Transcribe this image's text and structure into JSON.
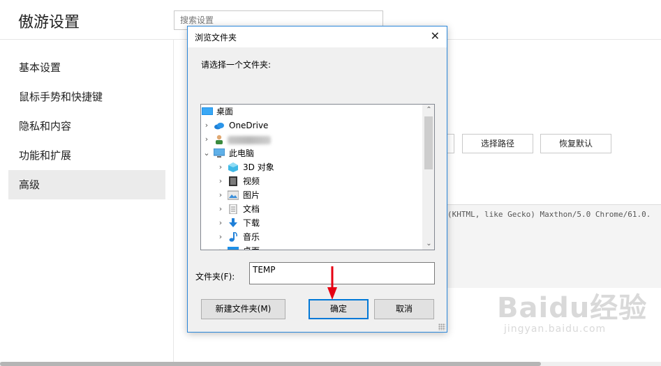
{
  "app": {
    "title": "傲游设置"
  },
  "search": {
    "placeholder": "搜索设置"
  },
  "sidebar": {
    "items": [
      {
        "label": "基本设置"
      },
      {
        "label": "鼠标手势和快捷键"
      },
      {
        "label": "隐私和内容"
      },
      {
        "label": "功能和扩展"
      },
      {
        "label": "高级",
        "active": true
      }
    ]
  },
  "background_buttons": {
    "select_path": "选择路径",
    "restore_default": "恢复默认"
  },
  "user_agent_text": "(KHTML, like Gecko) Maxthon/5.0 Chrome/61.0.",
  "dialog": {
    "title": "浏览文件夹",
    "prompt": "请选择一个文件夹:",
    "tree": [
      {
        "label": "桌面",
        "icon": "desktop-icon",
        "chevron": ""
      },
      {
        "label": "OneDrive",
        "icon": "onedrive-cloud-icon",
        "chevron": "›"
      },
      {
        "label": "",
        "icon": "user-icon",
        "chevron": "›",
        "blurred": true
      },
      {
        "label": "此电脑",
        "icon": "computer-icon",
        "chevron": "⌄"
      },
      {
        "label": "3D 对象",
        "icon": "3d-objects-icon",
        "chevron": "›"
      },
      {
        "label": "视频",
        "icon": "video-icon",
        "chevron": "›"
      },
      {
        "label": "图片",
        "icon": "pictures-icon",
        "chevron": "›"
      },
      {
        "label": "文档",
        "icon": "documents-icon",
        "chevron": "›"
      },
      {
        "label": "下载",
        "icon": "download-icon",
        "chevron": "›"
      },
      {
        "label": "音乐",
        "icon": "music-icon",
        "chevron": "›"
      },
      {
        "label": "桌面",
        "icon": "desktop-icon",
        "chevron": "›"
      }
    ],
    "folder_label": "文件夹(F):",
    "folder_value": "TEMP",
    "buttons": {
      "new_folder": "新建文件夹(M)",
      "ok": "确定",
      "cancel": "取消"
    },
    "close_glyph": "✕"
  },
  "watermark": {
    "logo": "Baidu经验",
    "url": "jingyan.baidu.com"
  },
  "colors": {
    "dialog_border": "#2a86d9",
    "focus_button_border": "#0078d7",
    "annotation_arrow": "#e60012",
    "sidebar_active_bg": "#ebebeb"
  }
}
